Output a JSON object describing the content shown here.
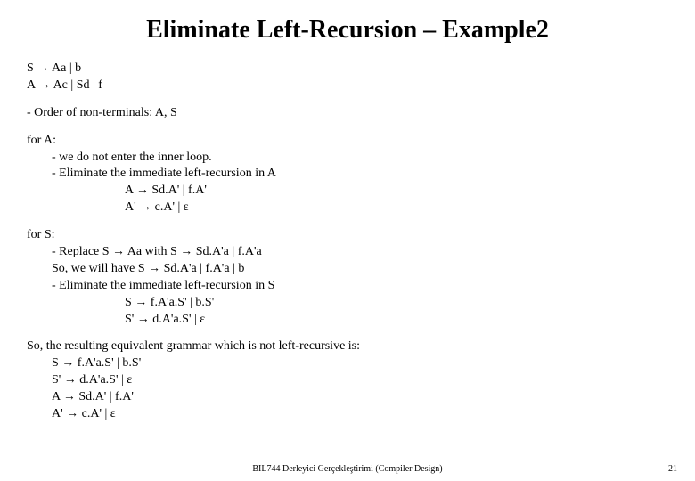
{
  "title": "Eliminate Left-Recursion – Example2",
  "grammar": {
    "line1": "S → Aa | b",
    "line2": "A → Ac | Sd | f"
  },
  "order": "- Order of non-terminals: A, S",
  "forA": {
    "head": "for A:",
    "l1": "- we do not enter the inner loop.",
    "l2": "- Eliminate the immediate left-recursion in A",
    "r1": "A → Sd.A' | f.A'",
    "r2": "A' → c.A' | ε"
  },
  "forS": {
    "head": "for S:",
    "l1": "- Replace   S → Aa   with   S → Sd.A'a  |  f.A'a",
    "l2": "  So, we will have  S → Sd.A'a  |  f.A'a  | b",
    "l3": "- Eliminate the immediate left-recursion in S",
    "r1": "S → f.A'a.S'  | b.S'",
    "r2": "S' → d.A'a.S'  |  ε"
  },
  "result": {
    "head": "So, the resulting equivalent grammar which is not left-recursive is:",
    "r1": "S → f.A'a.S'  | b.S'",
    "r2": "S' → d.A'a.S'  |  ε",
    "r3": "A → Sd.A' | f.A'",
    "r4": "A' → c.A' | ε"
  },
  "footer": "BIL744 Derleyici Gerçekleştirimi (Compiler Design)",
  "page": "21"
}
